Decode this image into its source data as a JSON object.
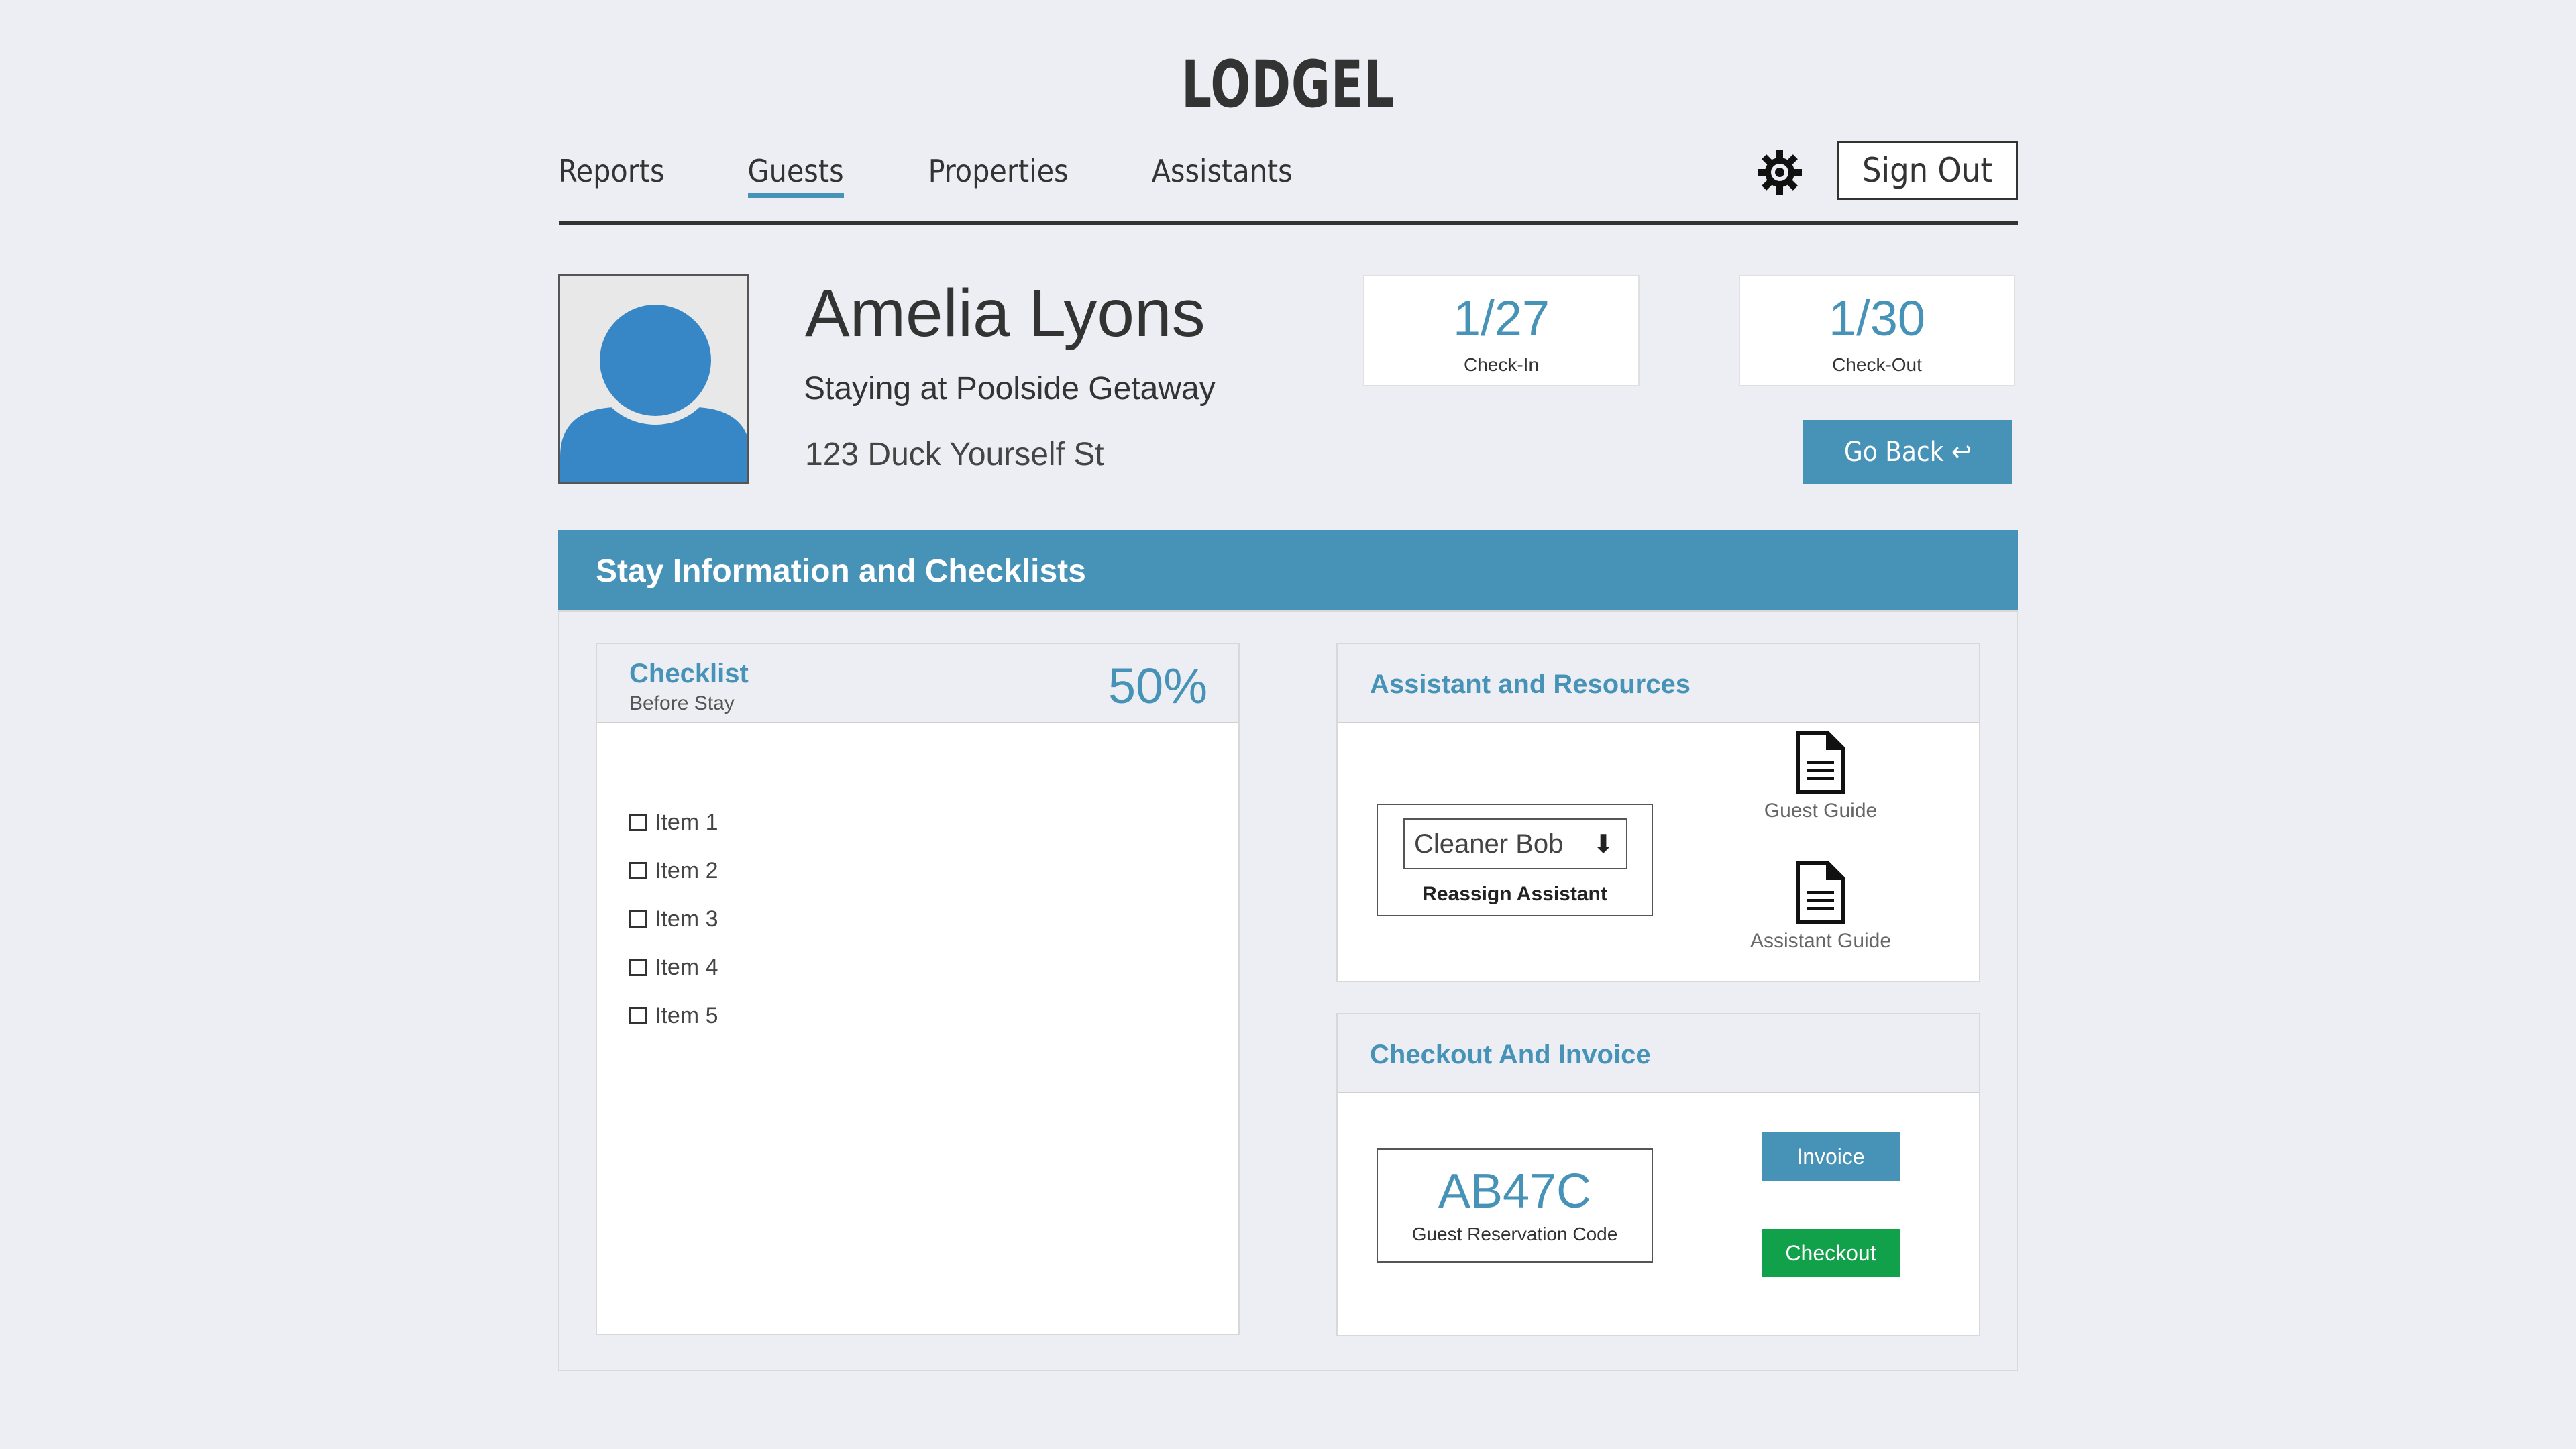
{
  "app": {
    "logo": "LODGEL"
  },
  "nav": {
    "items": [
      {
        "label": "Reports"
      },
      {
        "label": "Guests",
        "active": true
      },
      {
        "label": "Properties"
      },
      {
        "label": "Assistants"
      }
    ],
    "settings_icon": "gear-icon",
    "sign_out_label": "Sign Out"
  },
  "guest": {
    "name": "Amelia Lyons",
    "stay": "Staying at Poolside Getaway",
    "address": "123 Duck Yourself St",
    "check_in": {
      "value": "1/27",
      "label": "Check-In"
    },
    "check_out": {
      "value": "1/30",
      "label": "Check-Out"
    },
    "go_back_label": "Go Back ↩"
  },
  "section": {
    "title": "Stay Information and Checklists"
  },
  "checklist": {
    "title": "Checklist",
    "subtitle": "Before Stay",
    "percent": "50%",
    "items": [
      {
        "label": "Item 1"
      },
      {
        "label": "Item 2"
      },
      {
        "label": "Item 3"
      },
      {
        "label": "Item 4"
      },
      {
        "label": "Item 5"
      }
    ]
  },
  "assistant": {
    "title": "Assistant and Resources",
    "selected": "Cleaner Bob",
    "reassign_label": "Reassign Assistant",
    "guest_guide_label": "Guest Guide",
    "assistant_guide_label": "Assistant Guide"
  },
  "checkout": {
    "title": "Checkout And Invoice",
    "code": "AB47C",
    "code_label": "Guest Reservation Code",
    "invoice_label": "Invoice",
    "checkout_label": "Checkout"
  },
  "colors": {
    "accent": "#4793b8",
    "success": "#12a14b",
    "background": "#edeef3",
    "text": "#333333"
  }
}
